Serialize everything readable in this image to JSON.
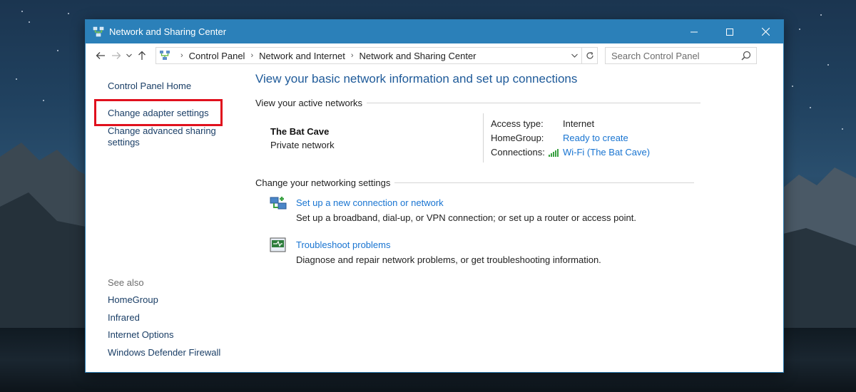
{
  "window": {
    "title": "Network and Sharing Center",
    "controls": {
      "minimize": "minimize",
      "maximize": "maximize",
      "close": "close"
    }
  },
  "address_bar": {
    "breadcrumbs": [
      "Control Panel",
      "Network and Internet",
      "Network and Sharing Center"
    ],
    "search_placeholder": "Search Control Panel"
  },
  "sidebar": {
    "home": "Control Panel Home",
    "adapter": "Change adapter settings",
    "advanced_line1": "Change advanced sharing",
    "advanced_line2": "settings",
    "see_also_label": "See also",
    "see_also": [
      "HomeGroup",
      "Infrared",
      "Internet Options",
      "Windows Defender Firewall"
    ]
  },
  "main": {
    "heading": "View your basic network information and set up connections",
    "active_networks_label": "View your active networks",
    "network": {
      "name": "The Bat Cave",
      "type": "Private network",
      "access_type_label": "Access type:",
      "access_type_value": "Internet",
      "homegroup_label": "HomeGroup:",
      "homegroup_value": "Ready to create",
      "connections_label": "Connections:",
      "connections_value": "Wi-Fi (The Bat Cave)"
    },
    "change_settings_label": "Change your networking settings",
    "tasks": [
      {
        "title": "Set up a new connection or network",
        "desc": "Set up a broadband, dial-up, or VPN connection; or set up a router or access point.",
        "icon": "network-setup-icon"
      },
      {
        "title": "Troubleshoot problems",
        "desc": "Diagnose and repair network problems, or get troubleshooting information.",
        "icon": "troubleshoot-icon"
      }
    ]
  },
  "colors": {
    "titlebar": "#2b80b9",
    "link": "#1874d1",
    "heading": "#1e5a99",
    "highlight": "#e0101d"
  }
}
